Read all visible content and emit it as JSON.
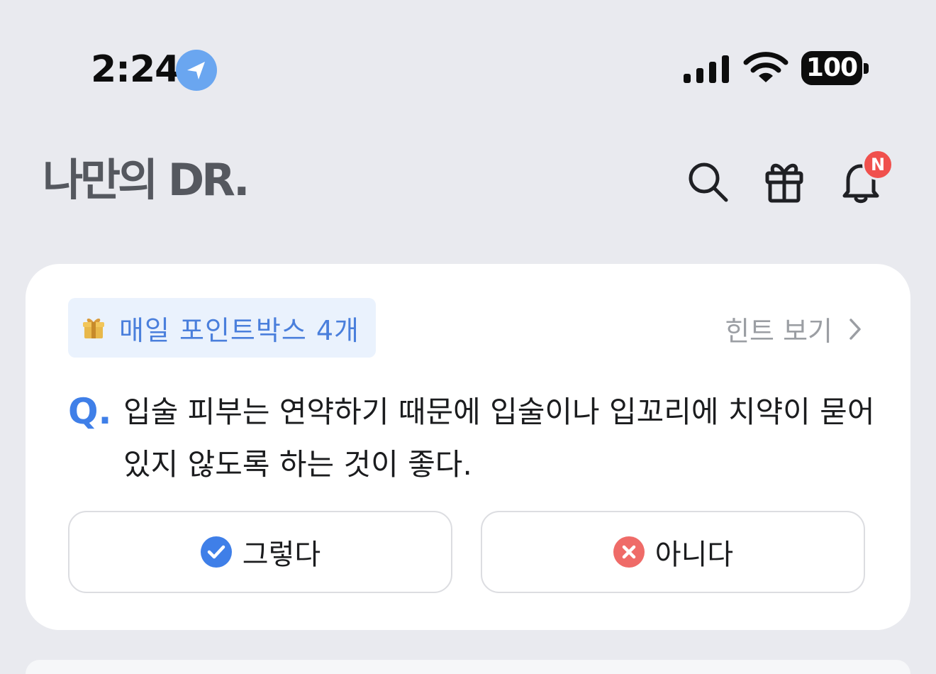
{
  "status_bar": {
    "time": "2:24",
    "battery": "100"
  },
  "header": {
    "logo": "나만의 DR.",
    "notification_badge": "N",
    "icons": [
      "search-icon",
      "gift-icon",
      "bell-icon"
    ]
  },
  "quiz": {
    "points_tag": "매일 포인트박스 4개",
    "hint_label": "힌트 보기",
    "q_prefix": "Q.",
    "question": "입술 피부는 연약하기 때문에 입술이나 입꼬리에 치약이 묻어있지 않도록 하는 것이 좋다.",
    "answers": [
      {
        "label": "그렇다",
        "icon": "check-circle-icon"
      },
      {
        "label": "아니다",
        "icon": "x-circle-icon"
      }
    ]
  },
  "colors": {
    "accent_blue": "#3f7fe8",
    "badge_red": "#f0504d",
    "background": "#e9eaef"
  }
}
